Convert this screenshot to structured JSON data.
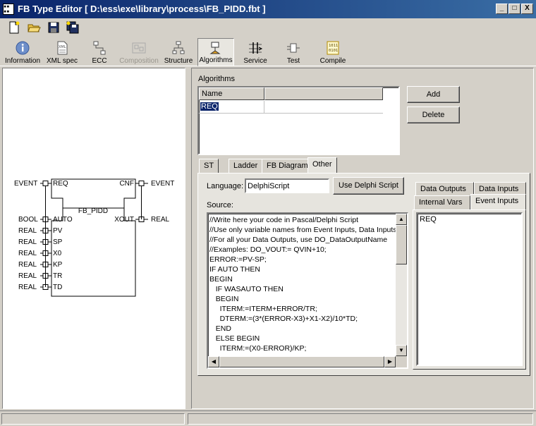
{
  "window": {
    "title": "FB Type Editor [ D:\\ess\\exe\\library\\process\\FB_PIDD.fbt ]",
    "controls": [
      "_",
      "□",
      "X"
    ]
  },
  "toolbar_icons": [
    "new-file-icon",
    "open-folder-icon",
    "save-icon",
    "save-all-icon"
  ],
  "tabs": [
    {
      "label": "Information",
      "icon": "info-icon",
      "state": "normal"
    },
    {
      "label": "XML spec",
      "icon": "xml-doc-icon",
      "state": "normal"
    },
    {
      "label": "ECC",
      "icon": "ecc-icon",
      "state": "normal"
    },
    {
      "label": "Composition",
      "icon": "composition-icon",
      "state": "disabled"
    },
    {
      "label": "Structure",
      "icon": "structure-icon",
      "state": "normal"
    },
    {
      "label": "Algorithms",
      "icon": "algorithms-icon",
      "state": "active"
    },
    {
      "label": "Service",
      "icon": "service-icon",
      "state": "normal"
    },
    {
      "label": "Test",
      "icon": "test-icon",
      "state": "normal"
    },
    {
      "label": "Compile",
      "icon": "compile-icon",
      "state": "normal"
    }
  ],
  "fb_diagram": {
    "name": "FB_PIDD",
    "event_inputs": [
      {
        "type": "EVENT",
        "name": "REQ"
      }
    ],
    "event_outputs": [
      {
        "type": "EVENT",
        "name": "CNF"
      }
    ],
    "data_inputs": [
      {
        "type": "BOOL",
        "name": "AUTO"
      },
      {
        "type": "REAL",
        "name": "PV"
      },
      {
        "type": "REAL",
        "name": "SP"
      },
      {
        "type": "REAL",
        "name": "X0"
      },
      {
        "type": "REAL",
        "name": "KP"
      },
      {
        "type": "REAL",
        "name": "TR"
      },
      {
        "type": "REAL",
        "name": "TD"
      }
    ],
    "data_outputs": [
      {
        "type": "REAL",
        "name": "XOUT"
      }
    ]
  },
  "algorithms": {
    "label": "Algorithms",
    "columns": [
      "Name",
      ""
    ],
    "rows": [
      {
        "name": "REQ",
        "comment": ""
      }
    ],
    "add_label": "Add",
    "delete_label": "Delete"
  },
  "lang_tabs": [
    "ST",
    "Ladder",
    "FB Diagram",
    "Other"
  ],
  "active_lang_tab": "Other",
  "editor": {
    "language_label": "Language:",
    "language_value": "DelphiScript",
    "use_button": "Use Delphi Script",
    "source_label": "Source:",
    "lines": [
      "//Write here your code in Pascal/Delphi Script",
      "//Use only variable names from Event Inputs, Data Inputs",
      "//For all your Data Outputs, use DO_DataOutputName",
      "//Examples: DO_VOUT:= QVIN+10;",
      "ERROR:=PV-SP;",
      "IF AUTO THEN",
      "BEGIN",
      "   IF WASAUTO THEN",
      "   BEGIN",
      "     ITERM:=ITERM+ERROR/TR;",
      "     DTERM:=(3*(ERROR-X3)+X1-X2)/10*TD;",
      "   END",
      "   ELSE BEGIN",
      "     ITERM:=(X0-ERROR)/KP;"
    ]
  },
  "var_tabs": {
    "row_back": [
      "Data Outputs",
      "Data Inputs"
    ],
    "row_front": [
      "Internal Vars",
      "Event Inputs"
    ],
    "active": "Event Inputs",
    "items": [
      "REQ"
    ]
  }
}
